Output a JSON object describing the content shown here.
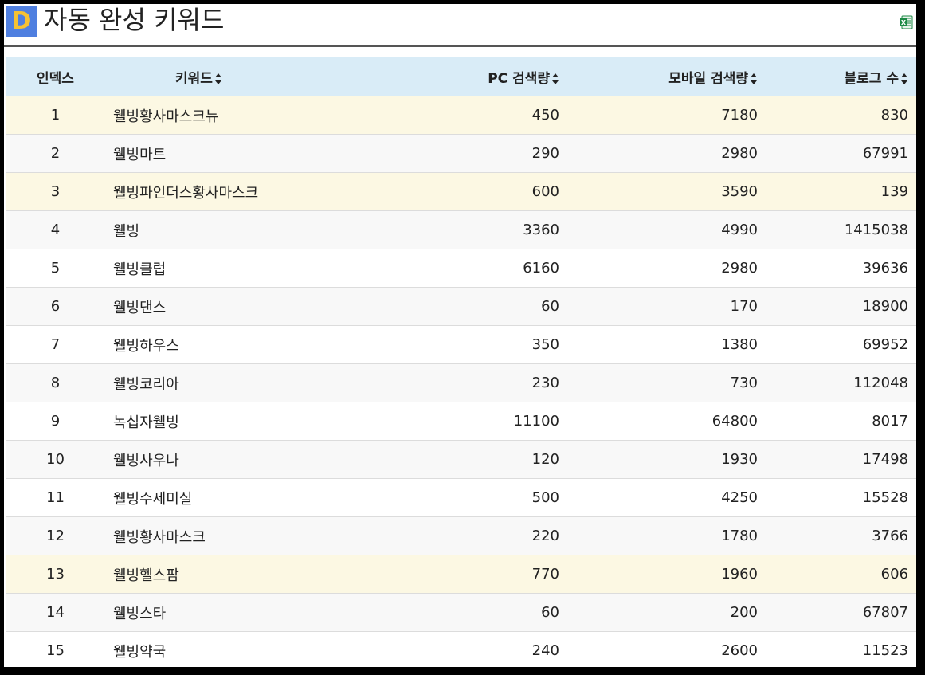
{
  "header": {
    "logo_letter": "D",
    "title": "자동 완성 키워드",
    "excel_icon": "excel-icon"
  },
  "colors": {
    "header_bg": "#d9ecf7",
    "highlight_row": "#fcf8e3",
    "logo_bg": "#4f7fe0",
    "logo_fg": "#f7c233",
    "excel_green": "#1d8a45"
  },
  "table": {
    "columns": [
      "인덱스",
      "키워드",
      "PC 검색량",
      "모바일 검색량",
      "블로그 수"
    ],
    "rows": [
      {
        "index": "1",
        "keyword": "웰빙황사마스크뉴",
        "pc": "450",
        "mobile": "7180",
        "blog": "830",
        "highlight": true
      },
      {
        "index": "2",
        "keyword": "웰빙마트",
        "pc": "290",
        "mobile": "2980",
        "blog": "67991",
        "highlight": false
      },
      {
        "index": "3",
        "keyword": "웰빙파인더스황사마스크",
        "pc": "600",
        "mobile": "3590",
        "blog": "139",
        "highlight": true
      },
      {
        "index": "4",
        "keyword": "웰빙",
        "pc": "3360",
        "mobile": "4990",
        "blog": "1415038",
        "highlight": false
      },
      {
        "index": "5",
        "keyword": "웰빙클럽",
        "pc": "6160",
        "mobile": "2980",
        "blog": "39636",
        "highlight": false
      },
      {
        "index": "6",
        "keyword": "웰빙댄스",
        "pc": "60",
        "mobile": "170",
        "blog": "18900",
        "highlight": false
      },
      {
        "index": "7",
        "keyword": "웰빙하우스",
        "pc": "350",
        "mobile": "1380",
        "blog": "69952",
        "highlight": false
      },
      {
        "index": "8",
        "keyword": "웰빙코리아",
        "pc": "230",
        "mobile": "730",
        "blog": "112048",
        "highlight": false
      },
      {
        "index": "9",
        "keyword": "녹십자웰빙",
        "pc": "11100",
        "mobile": "64800",
        "blog": "8017",
        "highlight": false
      },
      {
        "index": "10",
        "keyword": "웰빙사우나",
        "pc": "120",
        "mobile": "1930",
        "blog": "17498",
        "highlight": false
      },
      {
        "index": "11",
        "keyword": "웰빙수세미실",
        "pc": "500",
        "mobile": "4250",
        "blog": "15528",
        "highlight": false
      },
      {
        "index": "12",
        "keyword": "웰빙황사마스크",
        "pc": "220",
        "mobile": "1780",
        "blog": "3766",
        "highlight": false
      },
      {
        "index": "13",
        "keyword": "웰빙헬스팜",
        "pc": "770",
        "mobile": "1960",
        "blog": "606",
        "highlight": true
      },
      {
        "index": "14",
        "keyword": "웰빙스타",
        "pc": "60",
        "mobile": "200",
        "blog": "67807",
        "highlight": false
      },
      {
        "index": "15",
        "keyword": "웰빙약국",
        "pc": "240",
        "mobile": "2600",
        "blog": "11523",
        "highlight": false
      }
    ]
  }
}
